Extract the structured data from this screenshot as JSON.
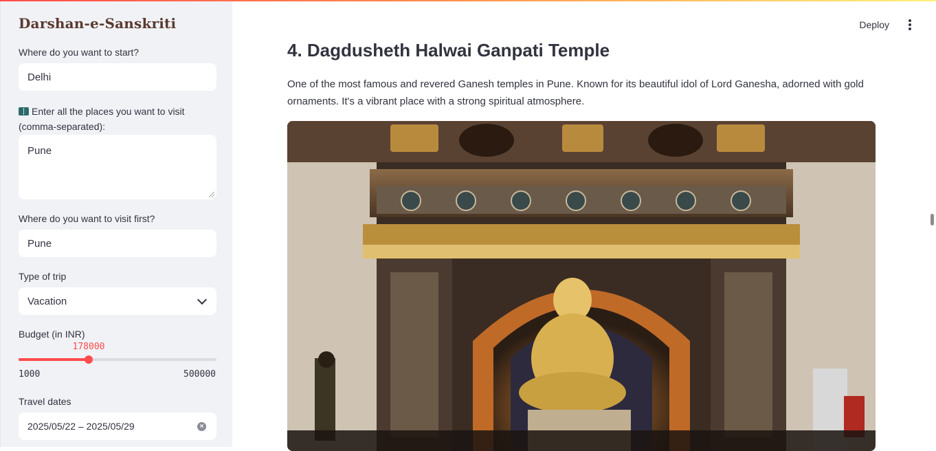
{
  "app_title": "Darshan-e-Sanskriti",
  "sidebar": {
    "start": {
      "label": "Where do you want to start?",
      "value": "Delhi"
    },
    "places": {
      "icon": "book-icon",
      "label": "Enter all the places you want to visit (comma-separated):",
      "value": "Pune"
    },
    "first": {
      "label": "Where do you want to visit first?",
      "value": "Pune"
    },
    "trip_type": {
      "label": "Type of trip",
      "value": "Vacation",
      "icon": "chevron-down-icon"
    },
    "budget": {
      "label": "Budget (in INR)",
      "value": "178000",
      "min": "1000",
      "max": "500000",
      "fraction": 0.3547
    },
    "dates": {
      "label": "Travel dates",
      "value": "2025/05/22 – 2025/05/29",
      "icon": "clear-icon"
    }
  },
  "header": {
    "deploy_label": "Deploy",
    "menu_icon": "kebab-menu-icon"
  },
  "content": {
    "heading": "4. Dagdusheth Halwai Ganpati Temple",
    "description": "One of the most famous and revered Ganesh temples in Pune. Known for its beautiful idol of Lord Ganesha, adorned with gold ornaments. It's a vibrant place with a strong spiritual atmosphere."
  },
  "colors": {
    "accent": "#ff4b4b",
    "sidebar_bg": "#f0f2f6",
    "title": "#5a3a2e",
    "text": "#31333f"
  }
}
